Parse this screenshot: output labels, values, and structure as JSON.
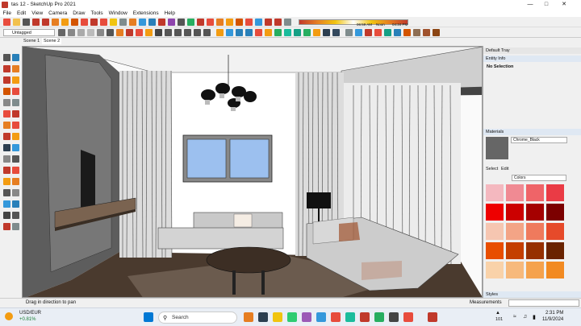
{
  "window": {
    "title": "tas 12 - SketchUp Pro 2021"
  },
  "menu": [
    "File",
    "Edit",
    "View",
    "Camera",
    "Draw",
    "Tools",
    "Window",
    "Extensions",
    "Help"
  ],
  "toolbar": {
    "shadow_time": "06:59 AM",
    "shadow_noon": "Noon",
    "shadow_time2": "04:34 PM",
    "layer": "Untagged"
  },
  "scenes": [
    "Scene 1",
    "Scene 2"
  ],
  "status": {
    "hint": "Drag in direction to pan",
    "measurements": "Measurements"
  },
  "tray": {
    "title": "Default Tray",
    "entity_info": {
      "header": "Entity Info",
      "selection": "No Selection"
    },
    "materials": {
      "header": "Materials",
      "name": "Chrome_Black",
      "tabs": [
        "Select",
        "Edit"
      ],
      "library": "Colors"
    },
    "styles_header": "Styles",
    "swatches": [
      "#f4b8bf",
      "#f08a93",
      "#ef6468",
      "#ea3b45",
      "#ee0000",
      "#cc0000",
      "#a50000",
      "#7c0000",
      "#f6c6b1",
      "#f3a486",
      "#ef7a5d",
      "#e64a2a",
      "#e84e00",
      "#c43f00",
      "#963000",
      "#6a2300",
      "#f9d2a9",
      "#f7b97c",
      "#f5a24d",
      "#f28a21"
    ]
  },
  "taskbar": {
    "ticker": "USD/EUR",
    "ticker_change": "+0.81%",
    "search_placeholder": "Search",
    "time": "2:31 PM",
    "date": "11/9/2024",
    "weather_num": "101"
  },
  "colors": {
    "accent": "#2b6cb0",
    "window_glass": "#9cc0ef",
    "floor": "#4a3a2e"
  }
}
